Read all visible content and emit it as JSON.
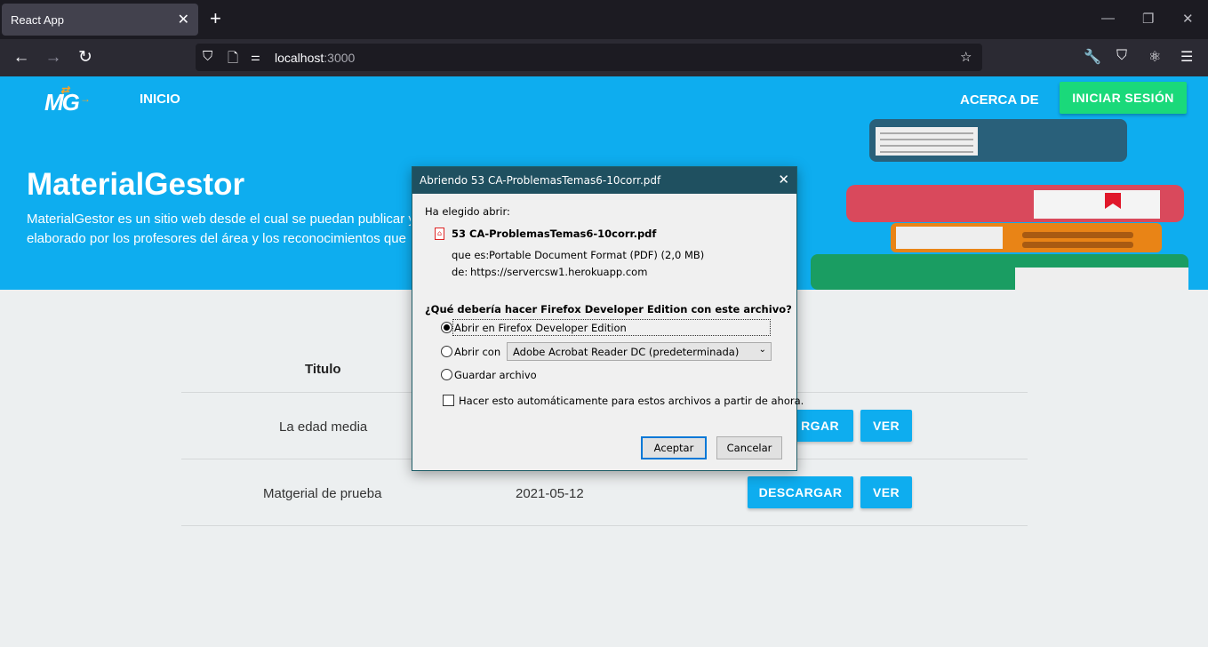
{
  "browser": {
    "tab_title": "React App",
    "url_host": "localhost",
    "url_port": ":3000"
  },
  "app": {
    "logo_text": "MG",
    "nav_home": "INICIO",
    "nav_about": "ACERCA DE",
    "login_button": "INICIAR SESIÓN",
    "hero_title": "MaterialGestor",
    "hero_desc_line1": "MaterialGestor es un sitio web desde el cual se puedan publicar y",
    "hero_desc_line2": "elaborado por los profesores del área y los reconocimientos que",
    "accent_color": "#0eadef",
    "login_color": "#1ad97a"
  },
  "table": {
    "header_title": "Titulo",
    "rows": [
      {
        "title": "La edad media",
        "date": "",
        "download": "DESCARGAR",
        "view": "VER"
      },
      {
        "title": "Matgerial de prueba",
        "date": "2021-05-12",
        "download": "DESCARGAR",
        "view": "VER"
      }
    ],
    "row1_download_visible": "RGAR"
  },
  "dialog": {
    "title": "Abriendo 53 CA-ProblemasTemas6-10corr.pdf",
    "chosen_label": "Ha elegido abrir:",
    "file_name": "53 CA-ProblemasTemas6-10corr.pdf",
    "type_label": "que es:",
    "type_value": "Portable Document Format (PDF) (2,0 MB)",
    "from_label": "de:",
    "from_value": "https://servercsw1.herokuapp.com",
    "question": "¿Qué debería hacer Firefox Developer Edition con este archivo?",
    "option_open_in": "Abrir en Firefox Developer Edition",
    "option_open_with": "Abrir con",
    "open_with_app": "Adobe Acrobat Reader DC (predeterminada)",
    "option_save": "Guardar archivo",
    "auto_checkbox": "Hacer esto automáticamente para estos archivos a partir de ahora.",
    "accept_button": "Aceptar",
    "cancel_button": "Cancelar",
    "selected_option": "open_in"
  }
}
